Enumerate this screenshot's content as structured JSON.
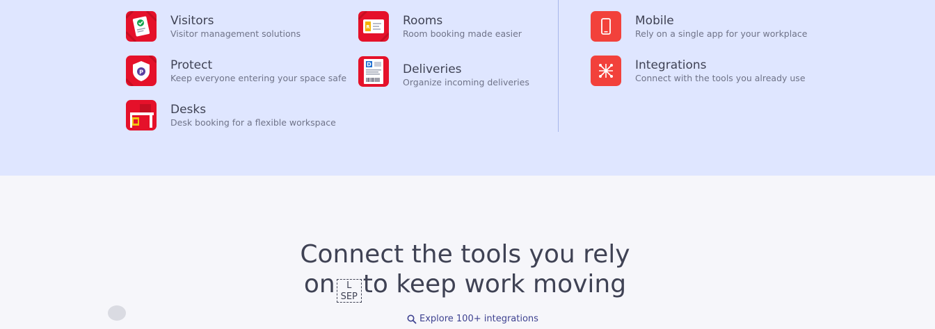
{
  "products": [
    {
      "title": "Visitors",
      "subtitle": "Visitor management solutions",
      "icon": "visitors-badge-icon"
    },
    {
      "title": "Protect",
      "subtitle": "Keep everyone entering your space safe",
      "icon": "protect-shield-icon"
    },
    {
      "title": "Desks",
      "subtitle": "Desk booking for a flexible workspace",
      "icon": "desk-icon"
    },
    {
      "title": "Rooms",
      "subtitle": "Room booking made easier",
      "icon": "room-display-icon"
    },
    {
      "title": "Deliveries",
      "subtitle": "Organize incoming deliveries",
      "icon": "delivery-label-icon"
    }
  ],
  "platform": [
    {
      "title": "Mobile",
      "subtitle": "Rely on a single app for your workplace",
      "icon": "mobile-phone-icon"
    },
    {
      "title": "Integrations",
      "subtitle": "Connect with the tools you already use",
      "icon": "integrations-network-icon"
    }
  ],
  "hero": {
    "headline_line1": "Connect the tools you rely",
    "headline_on": "on",
    "sep_top": "L",
    "sep_bottom": "SEP",
    "headline_rest": "to keep work moving",
    "explore_link": "Explore 100+ integrations"
  },
  "colors": {
    "accent": "#e5112a",
    "flat_icon": "#f2413b",
    "menu_bg": "#dfe6ff",
    "page_bg": "#f6f6fa"
  }
}
